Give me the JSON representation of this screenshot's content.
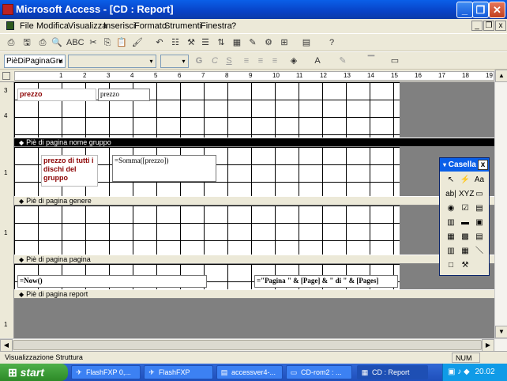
{
  "window": {
    "title": "Microsoft Access - [CD : Report]",
    "minimize": "_",
    "restore": "❐",
    "close": "✕"
  },
  "menu": {
    "items": [
      "File",
      "Modifica",
      "Visualizza",
      "Inserisci",
      "Formato",
      "Strumenti",
      "Finestra",
      "?"
    ],
    "mdi_min": "_",
    "mdi_restore": "❐",
    "mdi_close": "x"
  },
  "toolbar1": {
    "icons": [
      "view-icon",
      "save-icon",
      "print-icon",
      "preview-icon",
      "spelling-icon",
      "cut-icon",
      "copy-icon",
      "paste-icon",
      "format-painter-icon",
      "undo-icon",
      "field-list-icon",
      "properties-icon",
      "toolbox-icon",
      "sort-group-icon",
      "autoformat-icon",
      "code-icon",
      "build-icon",
      "database-window-icon",
      "new-object-icon",
      "help-icon"
    ],
    "glyphs": [
      "⎙",
      "🖫",
      "⎙",
      "🔍",
      "ABC",
      "✂",
      "⎘",
      "📋",
      "🖌",
      "↶",
      "☷",
      "⚒",
      "☰",
      "⇅",
      "▦",
      "✎",
      "⚙",
      "⊞",
      "▤",
      "?"
    ]
  },
  "toolbar2": {
    "object_combo": "PièDiPaginaGru",
    "font_combo": "",
    "size_combo": "",
    "bold": "G",
    "italic": "C",
    "underline": "S",
    "arrow": "▾"
  },
  "ruler": {
    "marks": [
      "1",
      "2",
      "3",
      "4",
      "5",
      "6",
      "7",
      "8",
      "9",
      "10",
      "11",
      "12",
      "13",
      "14",
      "15",
      "16",
      "17",
      "18",
      "19"
    ]
  },
  "report": {
    "bands": {
      "gruppo": "Piè di pagina nome gruppo",
      "genere": "Piè di pagina genere",
      "pagina": "Piè di pagina pagina",
      "report": "Piè di pagina report"
    },
    "controls": {
      "prezzo_label": "prezzo",
      "prezzo_field": "prezzo",
      "totale_label": "prezzo di tutti i dischi del gruppo",
      "somma_field": "=Somma([prezzo])",
      "now_field": "=Now()",
      "page_field": "=\"Pagina \" & [Page] & \" di \" & [Pages]"
    },
    "vruler_marks": [
      "3",
      "4",
      "1",
      "1",
      "1"
    ]
  },
  "toolbox": {
    "title": "Casella",
    "close": "x",
    "tools": [
      "↖",
      "⚡",
      "Aa",
      "ab|",
      "XYZ",
      "▭",
      "◉",
      "☑",
      "▤",
      "▥",
      "▬",
      "▣",
      "▦",
      "▩",
      "▤",
      "▥",
      "▦",
      "＼",
      "□",
      "⚒"
    ],
    "names": [
      "select-tool-icon",
      "wizard-tool-icon",
      "label-tool-icon",
      "textbox-tool-icon",
      "option-group-tool-icon",
      "toggle-tool-icon",
      "option-button-tool-icon",
      "checkbox-tool-icon",
      "combobox-tool-icon",
      "listbox-tool-icon",
      "command-button-tool-icon",
      "image-tool-icon",
      "unbound-object-tool-icon",
      "bound-object-tool-icon",
      "page-break-tool-icon",
      "tab-control-tool-icon",
      "subreport-tool-icon",
      "line-tool-icon",
      "rectangle-tool-icon",
      "more-controls-tool-icon"
    ]
  },
  "status": {
    "text": "Visualizzazione Struttura",
    "num": "NUM"
  },
  "taskbar": {
    "start": "start",
    "tasks": [
      "FlashFXP 0,...",
      "FlashFXP",
      "accessver4-...",
      "CD-rom2 : ...",
      "CD : Report"
    ],
    "clock": "20.02"
  }
}
